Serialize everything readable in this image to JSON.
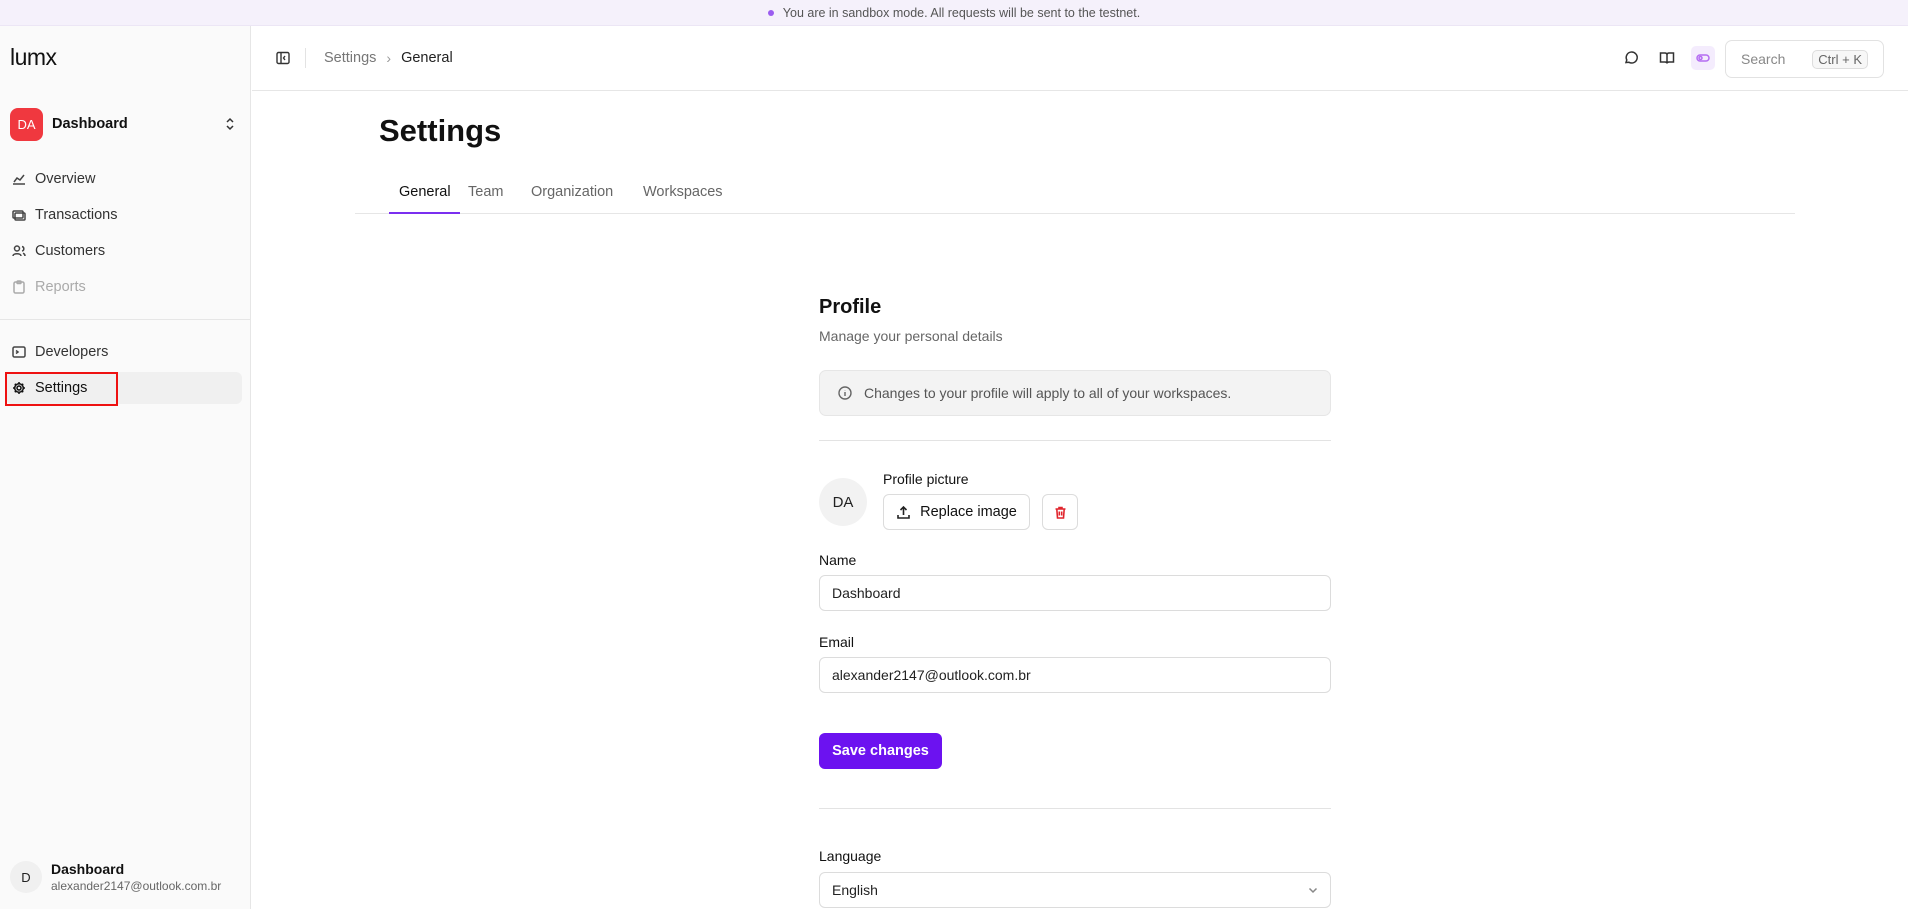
{
  "banner": {
    "text": "You are in sandbox mode. All requests will be sent to the testnet."
  },
  "sidebar": {
    "logo": "lumx",
    "workspace": {
      "initials": "DA",
      "name": "Dashboard"
    },
    "items": [
      {
        "label": "Overview",
        "icon": "chart-icon"
      },
      {
        "label": "Transactions",
        "icon": "transactions-icon"
      },
      {
        "label": "Customers",
        "icon": "users-icon"
      },
      {
        "label": "Reports",
        "icon": "clipboard-icon",
        "disabled": true
      },
      {
        "label": "Developers",
        "icon": "terminal-icon"
      },
      {
        "label": "Settings",
        "icon": "gear-icon",
        "active": true
      }
    ],
    "user": {
      "initial": "D",
      "name": "Dashboard",
      "email": "alexander2147@outlook.com.br"
    }
  },
  "topbar": {
    "breadcrumb": [
      "Settings",
      "General"
    ],
    "search": {
      "placeholder": "Search",
      "shortcut": "Ctrl + K"
    }
  },
  "main": {
    "title": "Settings",
    "tabs": [
      "General",
      "Team",
      "Organization",
      "Workspaces"
    ],
    "active_tab": "General",
    "profile": {
      "title": "Profile",
      "subtitle": "Manage your personal details",
      "notice": "Changes to your profile will apply to all of your workspaces.",
      "picture_label": "Profile picture",
      "avatar_initials": "DA",
      "replace_label": "Replace image",
      "name_label": "Name",
      "name_value": "Dashboard",
      "email_label": "Email",
      "email_value": "alexander2147@outlook.com.br",
      "save_label": "Save changes"
    },
    "language": {
      "label": "Language",
      "value": "English"
    }
  },
  "colors": {
    "accent": "#6c12f0",
    "workspace_avatar": "#f0383f",
    "highlight": "#ee1111"
  }
}
